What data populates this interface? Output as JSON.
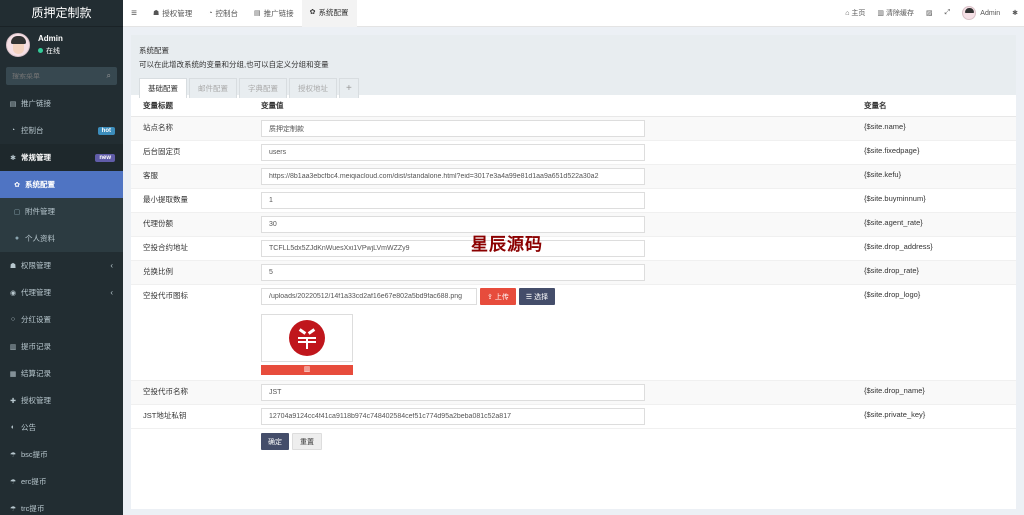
{
  "app": {
    "title": "质押定制款"
  },
  "user": {
    "name": "Admin",
    "status": "在线"
  },
  "sidebar": {
    "search_placeholder": "搜索菜单",
    "items": [
      {
        "label": "推广链接",
        "icon": "link-icon"
      },
      {
        "label": "控制台",
        "icon": "dashboard-icon",
        "badge": "hot",
        "badge_color": "#3c8dbc"
      },
      {
        "label": "常规管理",
        "icon": "cogs-icon",
        "badge": "new",
        "badge_color": "#605ca8"
      },
      {
        "label": "系统配置",
        "icon": "gear-icon"
      },
      {
        "label": "附件管理",
        "icon": "file-icon"
      },
      {
        "label": "个人资料",
        "icon": "user-icon"
      },
      {
        "label": "权限管理",
        "icon": "group-icon"
      },
      {
        "label": "代理管理",
        "icon": "list-icon"
      },
      {
        "label": "分红设置",
        "icon": "circle-icon"
      },
      {
        "label": "提币记录",
        "icon": "chart-icon"
      },
      {
        "label": "结算记录",
        "icon": "table-icon"
      },
      {
        "label": "授权管理",
        "icon": "shield-icon"
      },
      {
        "label": "公告",
        "icon": "adjust-icon"
      },
      {
        "label": "bsc提币",
        "icon": "shirt-icon"
      },
      {
        "label": "erc提币",
        "icon": "shirt-icon"
      },
      {
        "label": "trc提币",
        "icon": "shirt-icon"
      }
    ]
  },
  "navbar": {
    "tabs": [
      {
        "label": "授权管理",
        "icon": "users-icon"
      },
      {
        "label": "控制台",
        "icon": "dashboard-icon"
      },
      {
        "label": "推广链接",
        "icon": "link-icon"
      },
      {
        "label": "系统配置",
        "icon": "gear-icon"
      }
    ],
    "home": "主页",
    "clear_cache": "清除缓存",
    "admin": "Admin"
  },
  "panel": {
    "title": "系统配置",
    "desc": "可以在此增改系统的变量和分组,也可以自定义分组和变量",
    "tabs": [
      "基础配置",
      "邮件配置",
      "字典配置",
      "授权地址"
    ],
    "columns": {
      "name": "变量标题",
      "value": "变量值",
      "var": "变量名"
    },
    "rows": [
      {
        "label": "站点名称",
        "value": "质押定制款",
        "var": "{$site.name}"
      },
      {
        "label": "后台固定页",
        "value": "users",
        "var": "{$site.fixedpage}"
      },
      {
        "label": "客服",
        "value": "https://8b1aa3ebcfbc4.meiqiacloud.com/dist/standalone.html?eid=3017e3a4a99e81d1aa9a651d522a30a2",
        "var": "{$site.kefu}"
      },
      {
        "label": "最小提取数量",
        "value": "1",
        "var": "{$site.buyminnum}"
      },
      {
        "label": "代理份额",
        "value": "30",
        "var": "{$site.agent_rate}"
      },
      {
        "label": "空投合约地址",
        "value": "TCFLL5dx5ZJdKnWuesXxi1VPwjLVmWZZy9",
        "var": "{$site.drop_address}"
      },
      {
        "label": "兑换比例",
        "value": "5",
        "var": "{$site.drop_rate}"
      },
      {
        "label": "空投代币图标",
        "value": "/uploads/20220512/14f1a33cd2af16e67e802a5bd9fac688.png",
        "var": "{$site.drop_logo}"
      },
      {
        "label": "空投代币名称",
        "value": "JST",
        "var": "{$site.drop_name}"
      },
      {
        "label": "JST地址私钥",
        "value": "12704a9124cc4f41ca9118b974c748402584cef51c774d95a2beba081c52a817",
        "var": "{$site.private_key}"
      }
    ],
    "upload_label": "上传",
    "choose_label": "选择",
    "confirm_label": "确定",
    "reset_label": "重置"
  },
  "watermark": "星辰源码"
}
